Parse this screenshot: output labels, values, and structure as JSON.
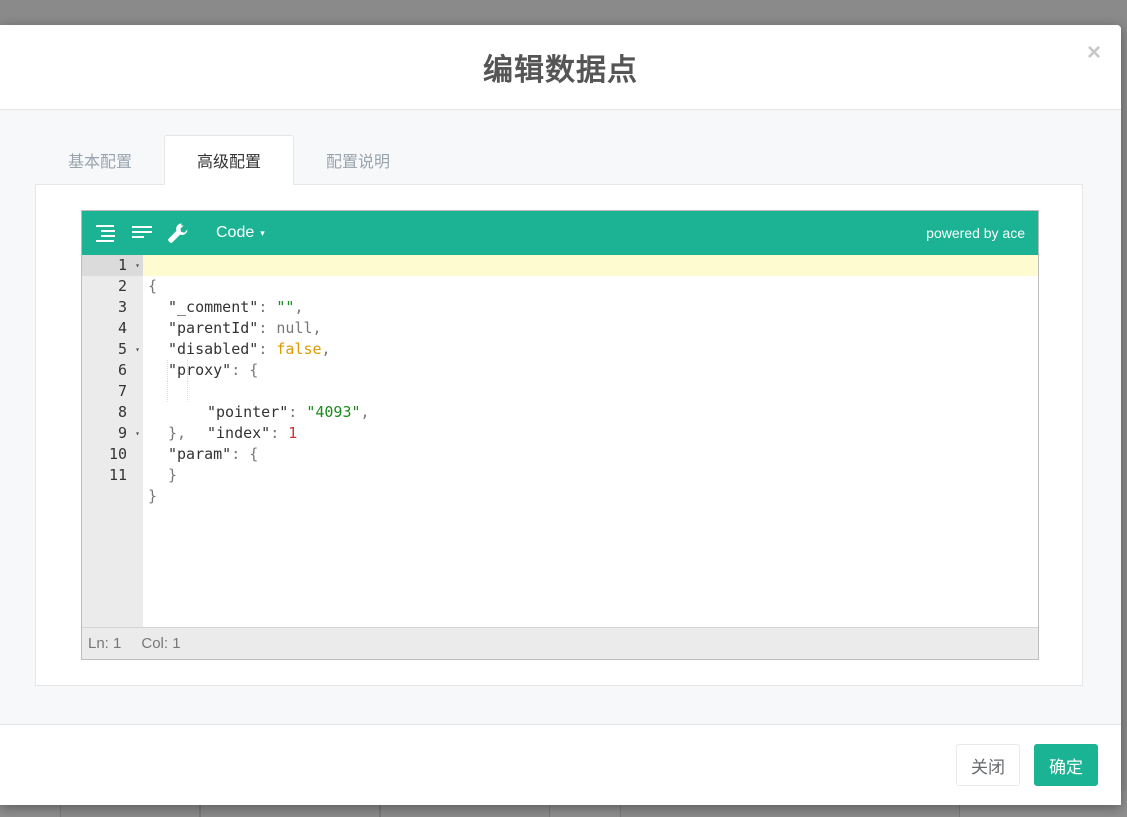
{
  "modal": {
    "title": "编辑数据点",
    "close_label": "×"
  },
  "tabs": [
    {
      "label": "基本配置",
      "active": false
    },
    {
      "label": "高级配置",
      "active": true
    },
    {
      "label": "配置说明",
      "active": false
    }
  ],
  "editor": {
    "mode_label": "Code",
    "mode_caret": "▾",
    "powered_by": "powered by ace",
    "icons": [
      "format-icon",
      "compact-icon",
      "repair-icon"
    ],
    "status": {
      "ln": "Ln: 1",
      "col": "Col: 1"
    },
    "line_numbers": [
      "1",
      "2",
      "3",
      "4",
      "5",
      "6",
      "7",
      "8",
      "9",
      "10",
      "11"
    ],
    "fold_marker": "▾"
  },
  "code": {
    "l1": "{",
    "l2_key": "\"_comment\"",
    "l2_colon": ": ",
    "l2_val": "\"\"",
    "l2_comma": ",",
    "l3_key": "\"parentId\"",
    "l3_colon": ": ",
    "l3_val": "null",
    "l3_comma": ",",
    "l4_key": "\"disabled\"",
    "l4_colon": ": ",
    "l4_val": "false",
    "l4_comma": ",",
    "l5_key": "\"proxy\"",
    "l5_colon": ": ",
    "l5_brace": "{",
    "l6_key": "\"pointer\"",
    "l6_colon": ": ",
    "l6_val": "\"4093\"",
    "l6_comma": ",",
    "l7_key": "\"index\"",
    "l7_colon": ": ",
    "l7_val": "1",
    "l8": "},",
    "l9_key": "\"param\"",
    "l9_colon": ": ",
    "l9_brace": "{",
    "l10": "}",
    "l11": "}"
  },
  "footer": {
    "close_label": "关闭",
    "ok_label": "确定"
  },
  "colors": {
    "accent": "#1ab394",
    "active_line": "#fffbd1",
    "string": "#1a8a1a",
    "number": "#d32f2f",
    "boolean": "#e09a00"
  }
}
